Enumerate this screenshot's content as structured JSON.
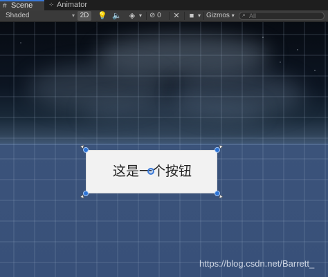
{
  "tabs": [
    {
      "label": "Scene",
      "icon": "scene-grid-icon",
      "active": true
    },
    {
      "label": "Animator",
      "icon": "animator-icon",
      "active": false
    }
  ],
  "toolbar": {
    "shading_mode": "Shaded",
    "mode_2d": "2D",
    "hidden_count": "0",
    "gizmos_label": "Gizmos",
    "search_placeholder": "All"
  },
  "scene": {
    "button_text": "这是一个按钮",
    "watermark": "https://blog.csdn.net/Barrett_"
  },
  "colors": {
    "tab_accent": "#3a79d8",
    "handle": "#2d74d6",
    "ground": "#385079",
    "sky_top": "#070b12"
  }
}
